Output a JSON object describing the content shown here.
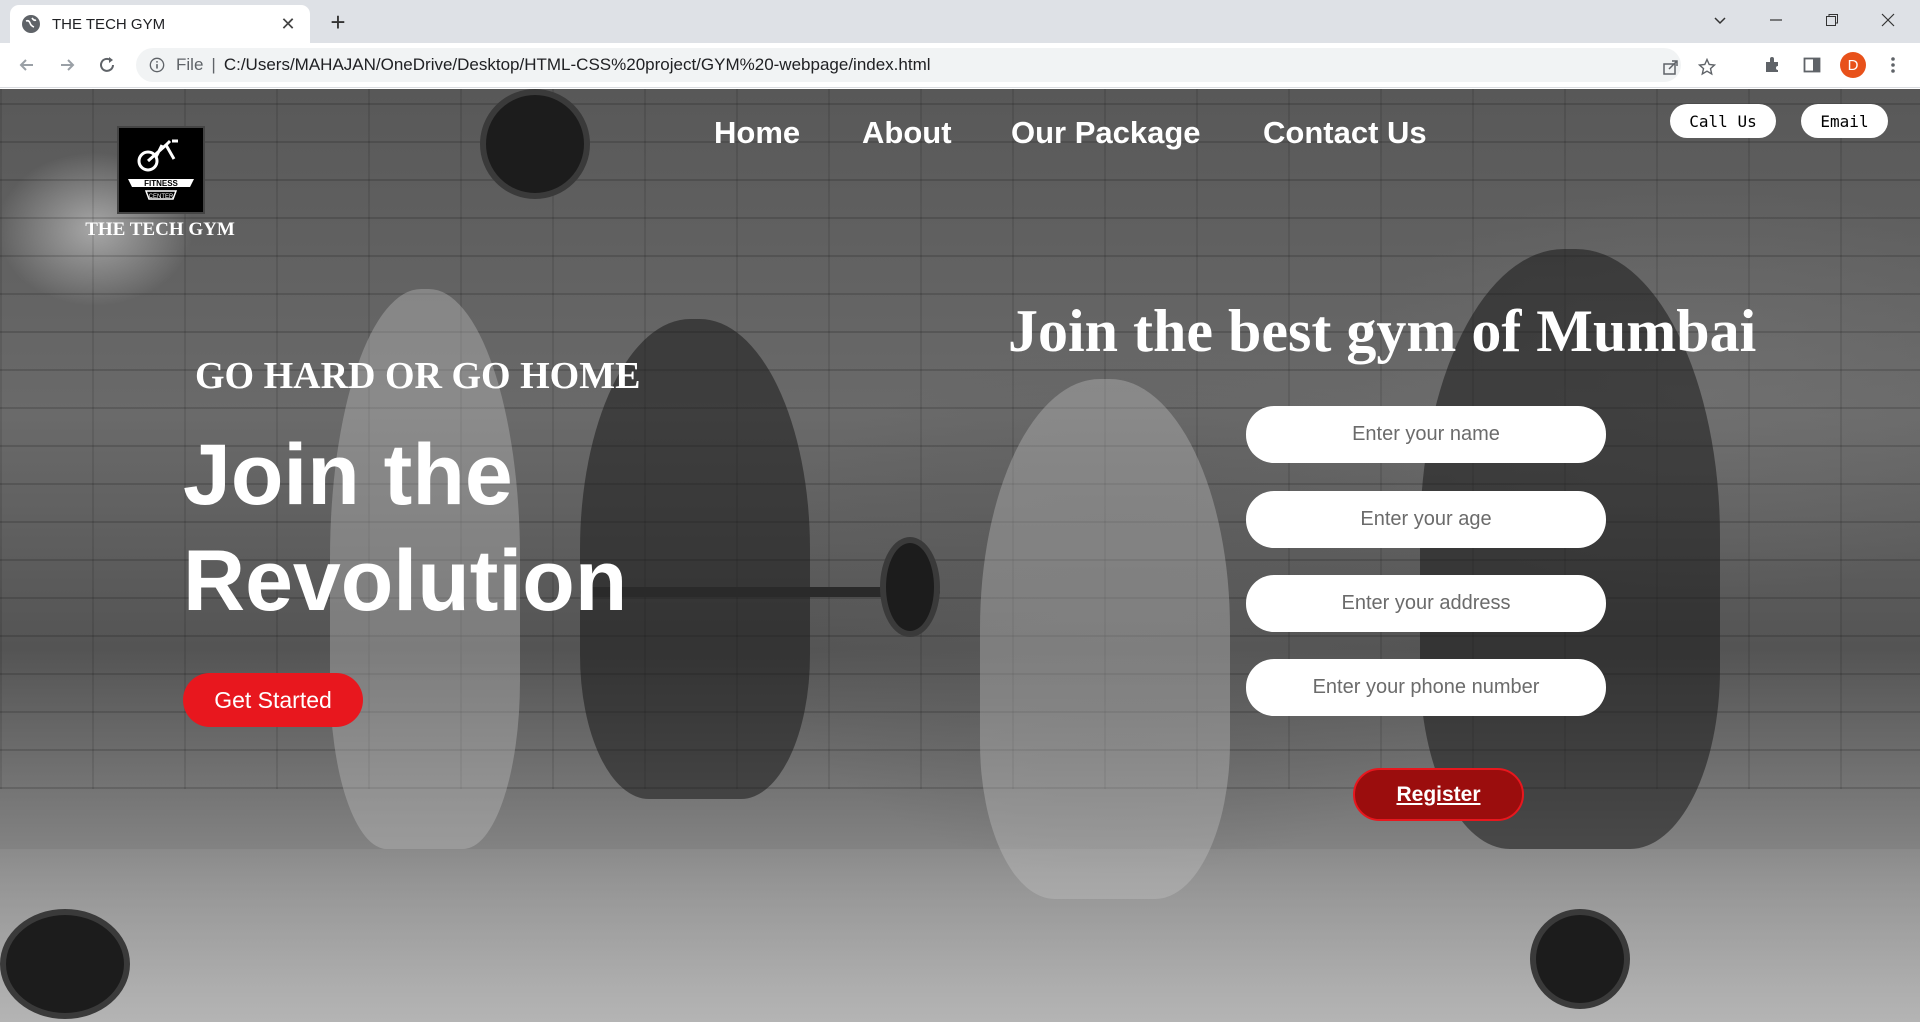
{
  "browser": {
    "tab_title": "THE TECH GYM",
    "omnibox_scheme": "File",
    "url": "C:/Users/MAHAJAN/OneDrive/Desktop/HTML-CSS%20project/GYM%20-webpage/index.html",
    "profile_initial": "D",
    "profile_color": "#e8511a"
  },
  "site": {
    "logo_text_top": "FITNESS",
    "logo_text_bottom": "CENTER",
    "brand_name": "THE TECH GYM",
    "nav": [
      "Home",
      "About",
      "Our Package",
      "Contact Us"
    ],
    "contact_buttons": [
      "Call Us",
      "Email"
    ]
  },
  "hero": {
    "slogan": "GO HARD OR GO HOME",
    "title_line1": "Join the",
    "title_line2": "Revolution",
    "cta_label": "Get Started",
    "cta_color": "#e8171e"
  },
  "form": {
    "heading": "Join the best gym of Mumbai",
    "fields": [
      {
        "placeholder": "Enter your name",
        "value": ""
      },
      {
        "placeholder": "Enter your age",
        "value": ""
      },
      {
        "placeholder": "Enter your address",
        "value": ""
      },
      {
        "placeholder": "Enter your phone number",
        "value": ""
      }
    ],
    "submit_label": "Register",
    "submit_color": "#9b0d0d"
  }
}
